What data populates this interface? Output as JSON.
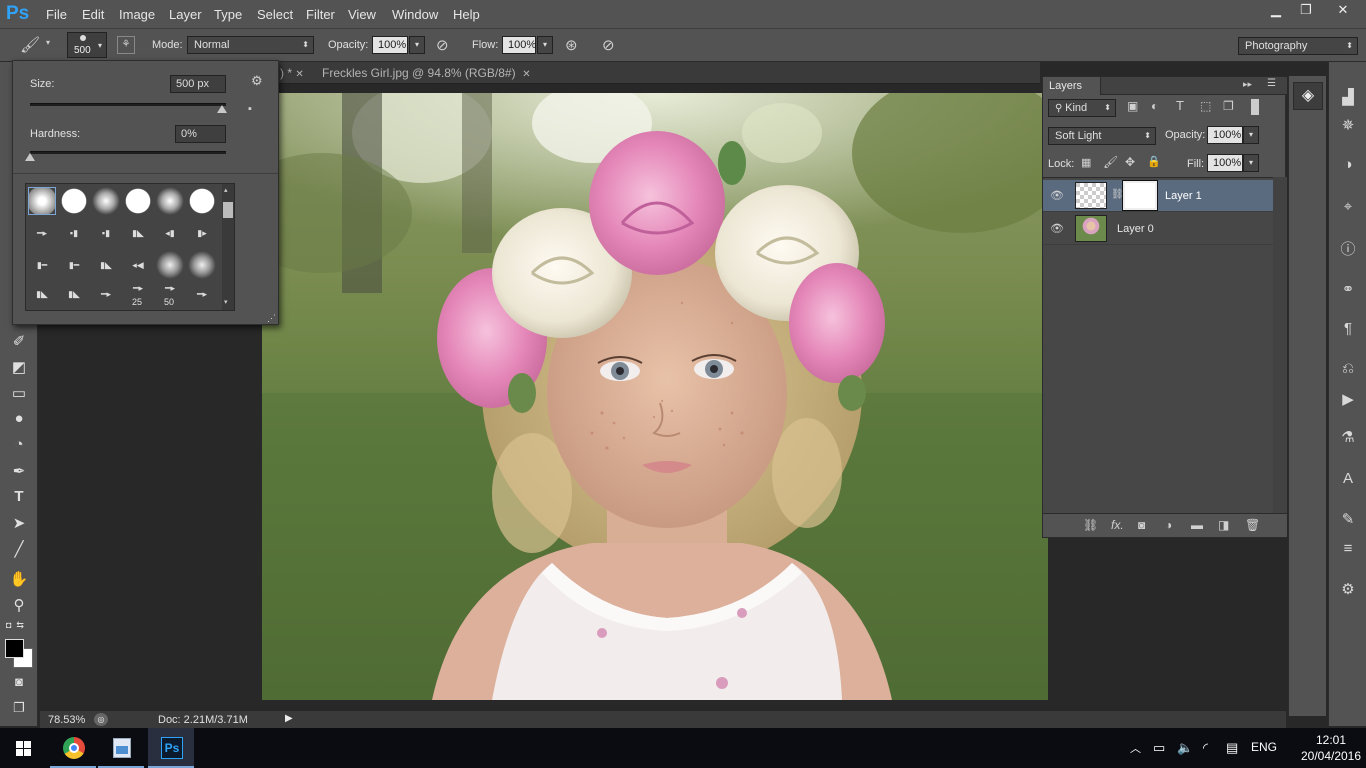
{
  "app": {
    "logo": "Ps",
    "minimize": "▁",
    "restore": "❐",
    "close": "✕"
  },
  "menu": [
    "File",
    "Edit",
    "Image",
    "Layer",
    "Type",
    "Select",
    "Filter",
    "View",
    "Window",
    "Help"
  ],
  "options": {
    "brush_size": "500",
    "mode_label": "Mode:",
    "mode_value": "Normal",
    "opacity_label": "Opacity:",
    "opacity_value": "100%",
    "flow_label": "Flow:",
    "flow_value": "100%",
    "workspace": "Photography"
  },
  "tabs": [
    {
      "label": ") *",
      "close": "✕"
    },
    {
      "label": "Freckles Girl.jpg @ 94.8% (RGB/8#)",
      "close": "✕"
    }
  ],
  "brush_popup": {
    "size_label": "Size:",
    "size_value": "500 px",
    "size_fraction": 0.98,
    "hardness_label": "Hardness:",
    "hardness_value": "0%",
    "hardness_fraction": 0.0,
    "tip_labels": [
      "25",
      "50"
    ]
  },
  "layers": {
    "title": "Layers",
    "kind": "Kind",
    "blend_mode": "Soft Light",
    "opacity_label": "Opacity:",
    "opacity_value": "100%",
    "lock_label": "Lock:",
    "fill_label": "Fill:",
    "fill_value": "100%",
    "items": [
      {
        "name": "Layer 1",
        "selected": true
      },
      {
        "name": "Layer 0",
        "selected": false
      }
    ],
    "footer_fx": "fx."
  },
  "status": {
    "zoom": "78.53%",
    "doc": "Doc: 2.21M/3.71M"
  },
  "taskbar": {
    "lang": "ENG",
    "time": "12:01",
    "date": "20/04/2016",
    "ps": "Ps"
  },
  "colors": {
    "ps_blue": "#2fa3f7",
    "panel": "#535353",
    "selected_layer": "#5a6a7f"
  }
}
